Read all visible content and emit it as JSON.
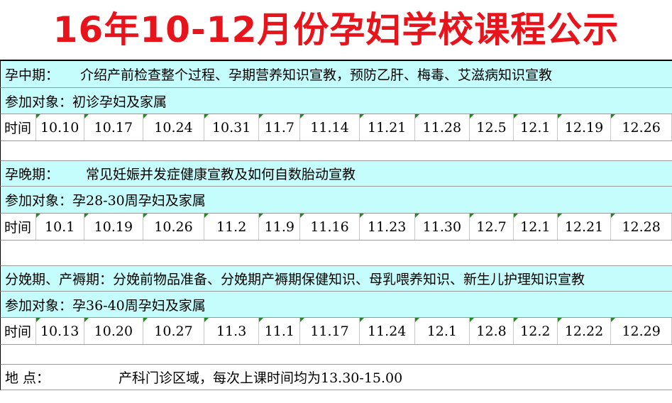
{
  "title": "16年10-12月份孕妇学校课程公示",
  "sections": [
    {
      "topic_label": "孕中期：",
      "topic": "介绍产前检查整个过程、孕期营养知识宣教，预防乙肝、梅毒、艾滋病知识宣教",
      "audience": "参加对象：初诊孕妇及家属",
      "time_label": "时间",
      "dates": [
        "10.10",
        "10.17",
        "10.24",
        "10.31",
        "11.7",
        "11.14",
        "11.21",
        "11.28",
        "12.5",
        "12.1",
        "12.19",
        "12.26"
      ]
    },
    {
      "topic_label": "孕晚期：",
      "topic": "常见妊娠并发症健康宣教及如何自数胎动宣教",
      "audience": "参加对象：孕28-30周孕妇及家属",
      "time_label": "时间",
      "dates": [
        "10.1",
        "10.19",
        "10.26",
        "11.2",
        "11.9",
        "11.16",
        "11.23",
        "11.30",
        "12.7",
        "12.1",
        "12.21",
        "12.28"
      ]
    },
    {
      "topic_label": "分娩期、产褥期：",
      "topic": "分娩前物品准备、分娩期产褥期保健知识、母乳喂养知识、新生儿护理知识宣教",
      "audience": "参加对象：孕36-40周孕妇及家属",
      "time_label": "时间",
      "dates": [
        "10.13",
        "10.20",
        "10.27",
        "11.3",
        "11.1",
        "11.17",
        "11.24",
        "12.1",
        "12.8",
        "12.2",
        "12.22",
        "12.29"
      ]
    }
  ],
  "location": {
    "label": "地        点：",
    "text": "产科门诊区域，每次上课时间均为13.30-15.00"
  },
  "colors": {
    "title": "#e8141c",
    "row_fill": "#c5fcfc",
    "cell_marker": "#1f8a1f"
  }
}
